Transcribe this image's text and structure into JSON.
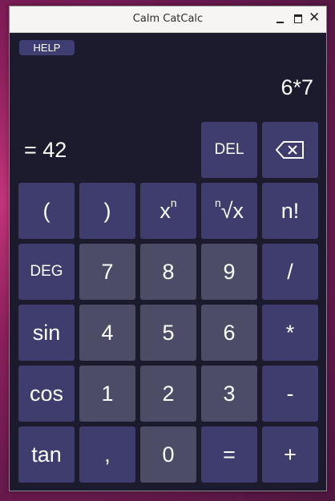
{
  "window": {
    "title": "Calm CatCalc",
    "controls": [
      "minimize-icon",
      "maximize-icon",
      "close-icon"
    ]
  },
  "help_label": "HELP",
  "display": {
    "expression": "6*7",
    "result": "= 42"
  },
  "keys": {
    "del": "DEL",
    "backspace_icon": "backspace-icon",
    "lparen": "(",
    "rparen": ")",
    "power_base": "x",
    "power_exp": "n",
    "root_index": "n",
    "root_rest": "√x",
    "factorial": "n!",
    "deg": "DEG",
    "seven": "7",
    "eight": "8",
    "nine": "9",
    "divide": "/",
    "sin": "sin",
    "four": "4",
    "five": "5",
    "six": "6",
    "multiply": "*",
    "cos": "cos",
    "one": "1",
    "two": "2",
    "three": "3",
    "minus": "-",
    "tan": "tan",
    "comma": ",",
    "zero": "0",
    "equals": "=",
    "plus": "+"
  },
  "colors": {
    "window_bg": "#1c1b2e",
    "operator_key": "#3e3d6e",
    "number_key": "#4d4c66",
    "text": "#ffffff"
  }
}
